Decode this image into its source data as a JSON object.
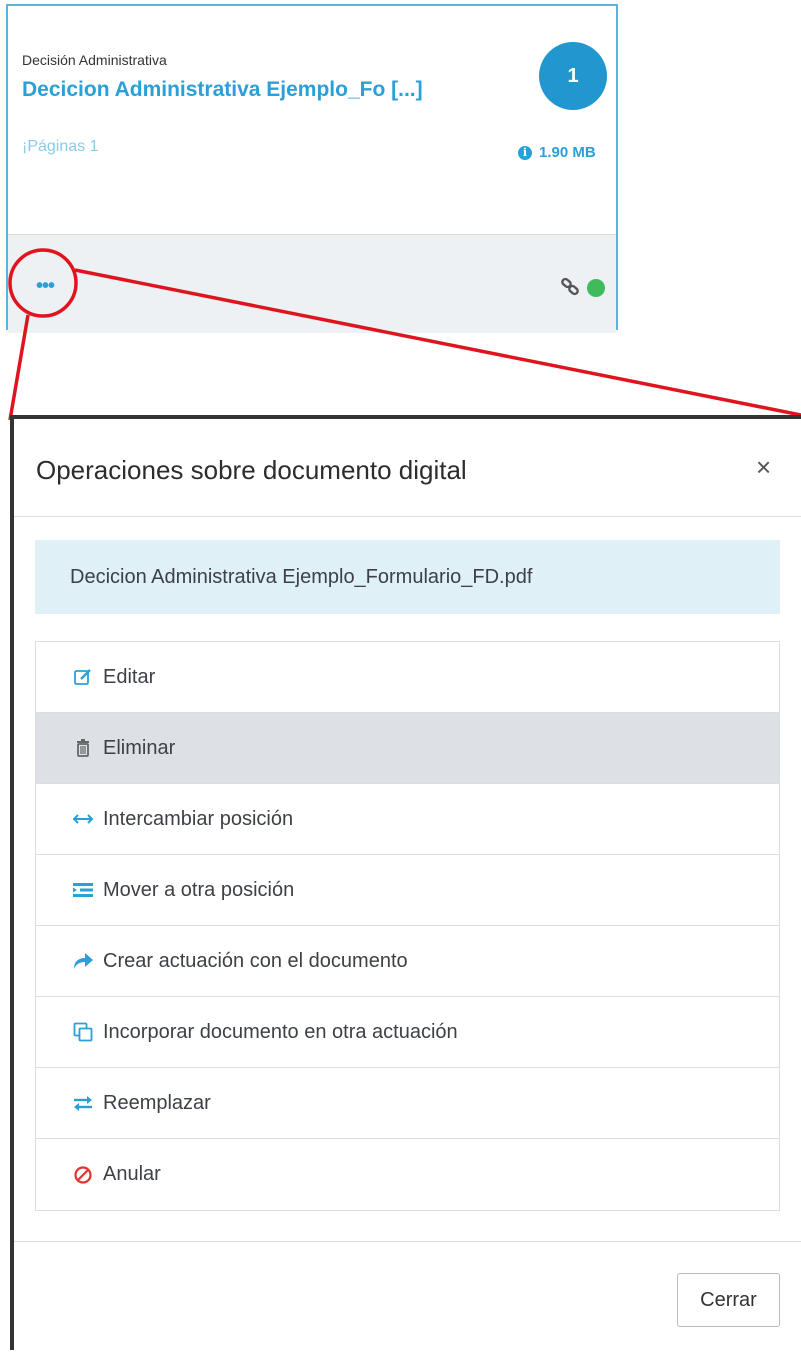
{
  "card": {
    "type_label": "Decisión Administrativa",
    "title": "Decicion Administrativa Ejemplo_Fo [...]",
    "badge": "1",
    "pages": "¡Páginas 1",
    "size": "1.90 MB",
    "more_label": "•••",
    "status_color": "#3fbb5e"
  },
  "modal": {
    "title": "Operaciones sobre documento digital",
    "close_label": "×",
    "file_name": "Decicion Administrativa Ejemplo_Formulario_FD.pdf",
    "operations": [
      {
        "label": "Editar",
        "icon": "edit-icon"
      },
      {
        "label": "Eliminar",
        "icon": "trash-icon"
      },
      {
        "label": "Intercambiar posición",
        "icon": "swap-horizontal-icon"
      },
      {
        "label": "Mover a otra posición",
        "icon": "indent-icon"
      },
      {
        "label": "Crear actuación con el documento",
        "icon": "share-arrow-icon"
      },
      {
        "label": "Incorporar documento en otra actuación",
        "icon": "copy-icon"
      },
      {
        "label": "Reemplazar",
        "icon": "exchange-icon"
      },
      {
        "label": "Anular",
        "icon": "ban-icon"
      }
    ],
    "close_button_label": "Cerrar"
  },
  "colors": {
    "accent": "#2b9fd7",
    "annotation": "#e0141e",
    "banner_bg": "#dff0f6",
    "selected_row": "#dde1e5"
  }
}
